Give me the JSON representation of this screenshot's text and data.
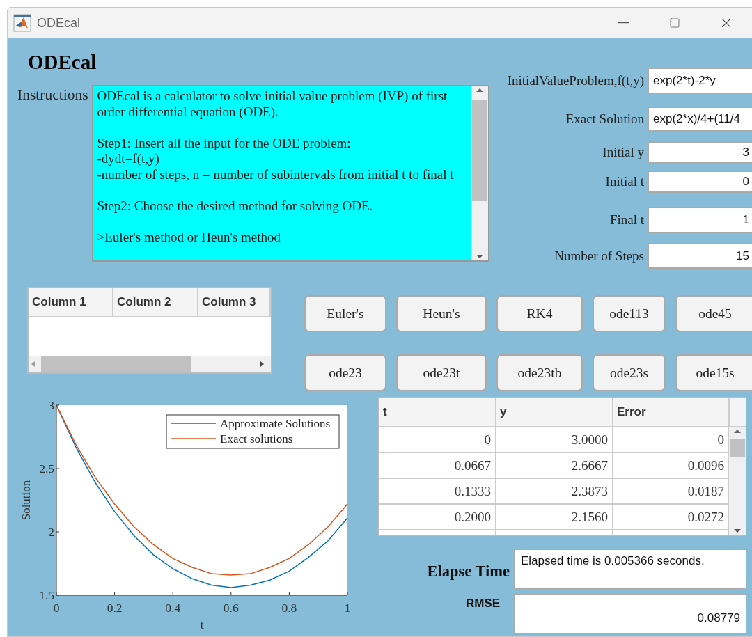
{
  "window": {
    "title": "ODEcal"
  },
  "app_title": "ODEcal",
  "instructions": {
    "label": "Instructions",
    "text": "ODEcal is a calculator to solve initial value problem (IVP) of first order differential equation (ODE).\n\nStep1: Insert all the input for the ODE problem:\n-dydt=f(t,y)\n-number of steps, n = number of subintervals from initial t to final t\n\nStep2: Choose the desired method for solving ODE.\n\n>Euler's method or Heun's method"
  },
  "inputs": [
    {
      "label": "InitialValueProblem,f(t,y)",
      "value": "exp(2*t)-2*y",
      "kind": "expression"
    },
    {
      "label": "Exact Solution",
      "value": "exp(2*x)/4+(11/4",
      "kind": "expression"
    },
    {
      "label": "Initial y",
      "value": "3",
      "kind": "number"
    },
    {
      "label": "Initial t",
      "value": "0",
      "kind": "number"
    },
    {
      "label": "Final t",
      "value": "1",
      "kind": "number"
    },
    {
      "label": "Number of Steps",
      "value": "15",
      "kind": "number"
    }
  ],
  "small_table": {
    "columns": [
      "Column 1",
      "Column 2",
      "Column 3"
    ]
  },
  "methods": [
    "Euler's",
    "Heun's",
    "RK4",
    "ode113",
    "ode45",
    "ode23",
    "ode23t",
    "ode23tb",
    "ode23s",
    "ode15s"
  ],
  "chart": {
    "chart_data": {
      "type": "line",
      "xlabel": "t",
      "ylabel": "Solution",
      "x": [
        0,
        0.0667,
        0.1333,
        0.2,
        0.2667,
        0.3333,
        0.4,
        0.4667,
        0.5333,
        0.6,
        0.6667,
        0.7333,
        0.8,
        0.8667,
        0.9333,
        1
      ],
      "series": [
        {
          "name": "Approximate Solutions",
          "color": "#0072bd",
          "values": [
            3,
            2.67,
            2.39,
            2.16,
            1.97,
            1.82,
            1.71,
            1.63,
            1.58,
            1.56,
            1.58,
            1.62,
            1.69,
            1.8,
            1.93,
            2.11
          ]
        },
        {
          "name": "Exact solutions",
          "color": "#d95319",
          "values": [
            3,
            2.69,
            2.43,
            2.22,
            2.04,
            1.9,
            1.79,
            1.72,
            1.67,
            1.66,
            1.67,
            1.72,
            1.79,
            1.9,
            2.04,
            2.22
          ]
        }
      ],
      "legend": true,
      "xlim": [
        0,
        1
      ],
      "ylim": [
        1.5,
        3
      ],
      "xticks": [
        0,
        0.2,
        0.4,
        0.6,
        0.8,
        1
      ],
      "yticks": [
        1.5,
        2,
        2.5,
        3
      ]
    }
  },
  "results_table": {
    "columns": [
      "t",
      "y",
      "Error"
    ],
    "rows": [
      [
        "0",
        "3.0000",
        "0"
      ],
      [
        "0.0667",
        "2.6667",
        "0.0096"
      ],
      [
        "0.1333",
        "2.3873",
        "0.0187"
      ],
      [
        "0.2000",
        "2.1560",
        "0.0272"
      ]
    ]
  },
  "elapse_time": {
    "label": "Elapse Time",
    "value": "Elapsed time is 0.005366 seconds."
  },
  "rmse": {
    "label": "RMSE",
    "value": "0.08779"
  }
}
